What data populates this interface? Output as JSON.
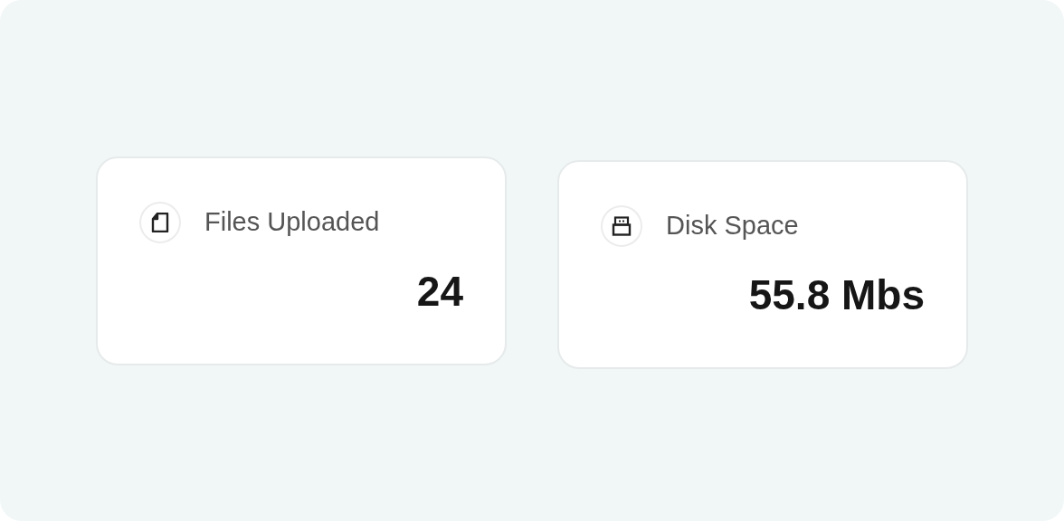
{
  "cards": [
    {
      "kind": "file",
      "label": "Files Uploaded",
      "value": "24"
    },
    {
      "kind": "drive",
      "label": "Disk Space",
      "value": "55.8 Mbs"
    }
  ]
}
